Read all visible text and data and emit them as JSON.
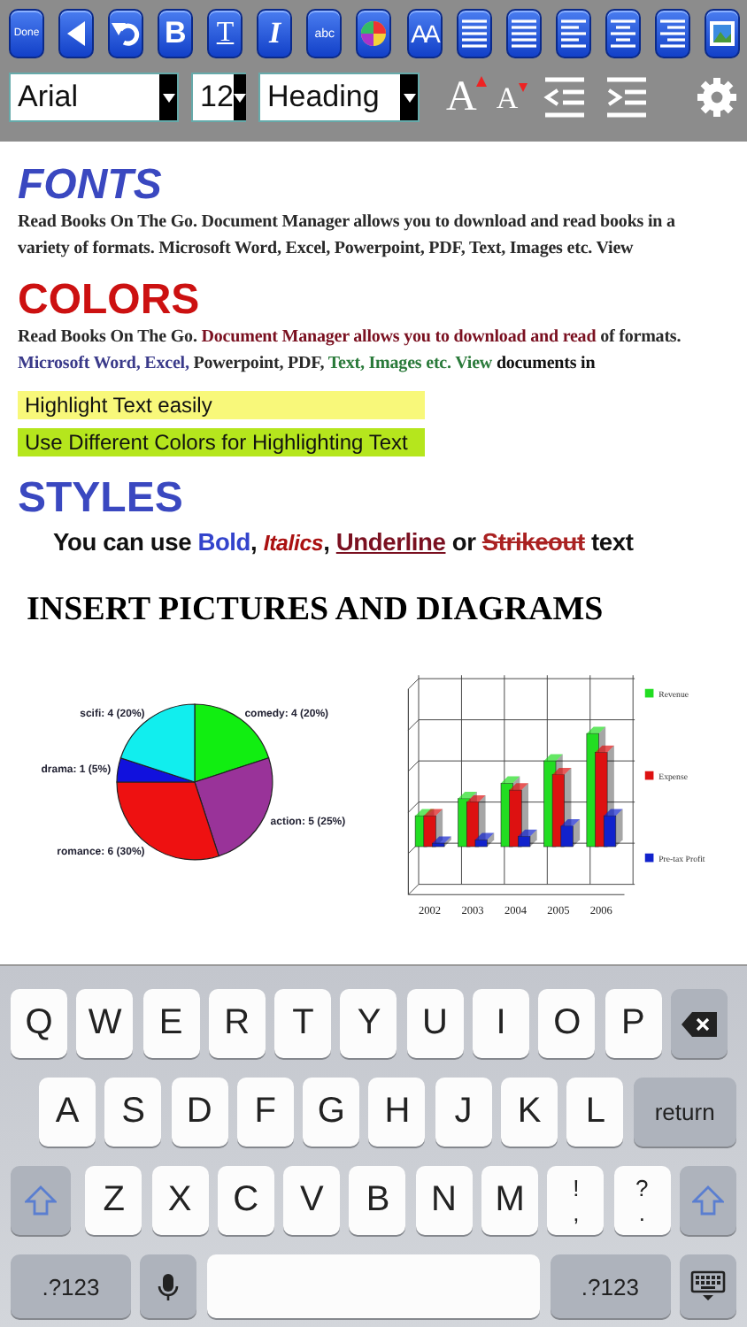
{
  "toolbar": {
    "buttons": [
      {
        "kind": "text",
        "label": "Done"
      },
      {
        "kind": "back"
      },
      {
        "kind": "undo"
      },
      {
        "kind": "bold",
        "label": "B"
      },
      {
        "kind": "underline",
        "label": "T"
      },
      {
        "kind": "italic",
        "label": "I"
      },
      {
        "kind": "strike",
        "label": "abc"
      },
      {
        "kind": "palette"
      },
      {
        "kind": "size",
        "label": "AA"
      },
      {
        "kind": "bullets"
      },
      {
        "kind": "numbers"
      },
      {
        "kind": "align-left"
      },
      {
        "kind": "align-center"
      },
      {
        "kind": "align-right"
      },
      {
        "kind": "image"
      }
    ]
  },
  "format_bar": {
    "font": "Arial",
    "size": "12",
    "style": "Heading",
    "grow_label": "A",
    "shrink_label": "A"
  },
  "document": {
    "blocks": [
      {
        "kind": "heading",
        "text": "FONTS",
        "color": "#3a48c0",
        "italic": true
      },
      {
        "kind": "paragraph",
        "segments": [
          {
            "kind": "plain",
            "text": "Read Books On The Go. Document Manager allows you to download and read books in a variety of formats. Microsoft Word, Excel, Powerpoint, PDF, Text, Images etc. View",
            "color": "#2a2a2a"
          }
        ]
      },
      {
        "kind": "heading",
        "text": "COLORS",
        "color": "#cc1111",
        "italic": false
      },
      {
        "kind": "paragraph",
        "segments": [
          {
            "kind": "plain",
            "text": "Read Books On The Go. ",
            "color": "#2a2a2a"
          },
          {
            "kind": "plain",
            "text": "Document Manager allows you to download and read",
            "color": "#7a1020"
          },
          {
            "kind": "plain",
            "text": " of formats. ",
            "color": "#2a2a2a"
          },
          {
            "kind": "plain",
            "text": "Microsoft Word, Excel,",
            "color": "#3a3a8a"
          },
          {
            "kind": "plain",
            "text": " Powerpoint, PDF, ",
            "color": "#2a2a2a"
          },
          {
            "kind": "plain",
            "text": "Text, Images etc. View",
            "color": "#2a7a3a"
          },
          {
            "kind": "plain",
            "text": " documents in",
            "color": "#111111"
          }
        ]
      },
      {
        "kind": "highlight",
        "text": "Highlight Text easily",
        "color": "#f8f87a"
      },
      {
        "kind": "highlight",
        "text": "Use Different Colors for Highlighting Text",
        "color": "#b5e61d"
      },
      {
        "kind": "heading",
        "text": "STYLES",
        "color": "#3a48c0",
        "italic": false
      },
      {
        "kind": "styles",
        "segments": [
          {
            "kind": "plain",
            "text": "You can use ",
            "color": "#111111"
          },
          {
            "kind": "plain",
            "text": "Bold",
            "color": "#3344cc"
          },
          {
            "kind": "plain",
            "text": ", ",
            "color": "#111111"
          },
          {
            "kind": "italic",
            "text": "Italics",
            "color": "#aa1111"
          },
          {
            "kind": "plain",
            "text": ", ",
            "color": "#111111"
          },
          {
            "kind": "underline",
            "text": "Underline",
            "color": "#7a1020"
          },
          {
            "kind": "plain",
            "text": " or ",
            "color": "#111111"
          },
          {
            "kind": "strike",
            "text": "Strikeout",
            "color": "#aa2222"
          },
          {
            "kind": "plain",
            "text": " text",
            "color": "#111111"
          }
        ]
      },
      {
        "kind": "title",
        "text": "INSERT PICTURES AND DIAGRAMS"
      }
    ]
  },
  "pie_figure": {
    "chart_data": {
      "type": "pie",
      "categories": [
        "comedy: 4 (20%)",
        "action: 5 (25%)",
        "romance: 6 (30%)",
        "drama: 1 (5%)",
        "scifi: 4 (20%)"
      ],
      "values": [
        4,
        5,
        6,
        1,
        4
      ]
    }
  },
  "bar_figure": {
    "x_labels": [
      "2002",
      "2003",
      "2004",
      "2005",
      "2006"
    ],
    "legend": [
      {
        "label": "Revenue",
        "color": "#22dd22"
      },
      {
        "label": "Expense",
        "color": "#dd1111"
      },
      {
        "label": "Pre-tax Profit",
        "color": "#1122cc"
      }
    ]
  },
  "keyboard": {
    "rows": [
      {
        "keys": [
          {
            "kind": "letter",
            "label": "Q"
          },
          {
            "kind": "letter",
            "label": "W"
          },
          {
            "kind": "letter",
            "label": "E"
          },
          {
            "kind": "letter",
            "label": "R"
          },
          {
            "kind": "letter",
            "label": "T"
          },
          {
            "kind": "letter",
            "label": "Y"
          },
          {
            "kind": "letter",
            "label": "U"
          },
          {
            "kind": "letter",
            "label": "I"
          },
          {
            "kind": "letter",
            "label": "O"
          },
          {
            "kind": "letter",
            "label": "P"
          },
          {
            "kind": "backspace"
          }
        ]
      },
      {
        "keys": [
          {
            "kind": "letter",
            "label": "A"
          },
          {
            "kind": "letter",
            "label": "S"
          },
          {
            "kind": "letter",
            "label": "D"
          },
          {
            "kind": "letter",
            "label": "F"
          },
          {
            "kind": "letter",
            "label": "G"
          },
          {
            "kind": "letter",
            "label": "H"
          },
          {
            "kind": "letter",
            "label": "J"
          },
          {
            "kind": "letter",
            "label": "K"
          },
          {
            "kind": "letter",
            "label": "L"
          },
          {
            "kind": "return",
            "label": "return"
          }
        ]
      },
      {
        "keys": [
          {
            "kind": "shift"
          },
          {
            "kind": "letter",
            "label": "Z"
          },
          {
            "kind": "letter",
            "label": "X"
          },
          {
            "kind": "letter",
            "label": "C"
          },
          {
            "kind": "letter",
            "label": "V"
          },
          {
            "kind": "letter",
            "label": "B"
          },
          {
            "kind": "letter",
            "label": "N"
          },
          {
            "kind": "letter",
            "label": "M"
          },
          {
            "kind": "punct",
            "label": "!",
            "alt": ","
          },
          {
            "kind": "punct",
            "label": "?",
            "alt": "."
          },
          {
            "kind": "shift"
          }
        ]
      },
      {
        "keys": [
          {
            "kind": "mode",
            "label": ".?123"
          },
          {
            "kind": "mic"
          },
          {
            "kind": "space"
          },
          {
            "kind": "mode",
            "label": ".?123"
          },
          {
            "kind": "hide"
          }
        ]
      }
    ]
  }
}
